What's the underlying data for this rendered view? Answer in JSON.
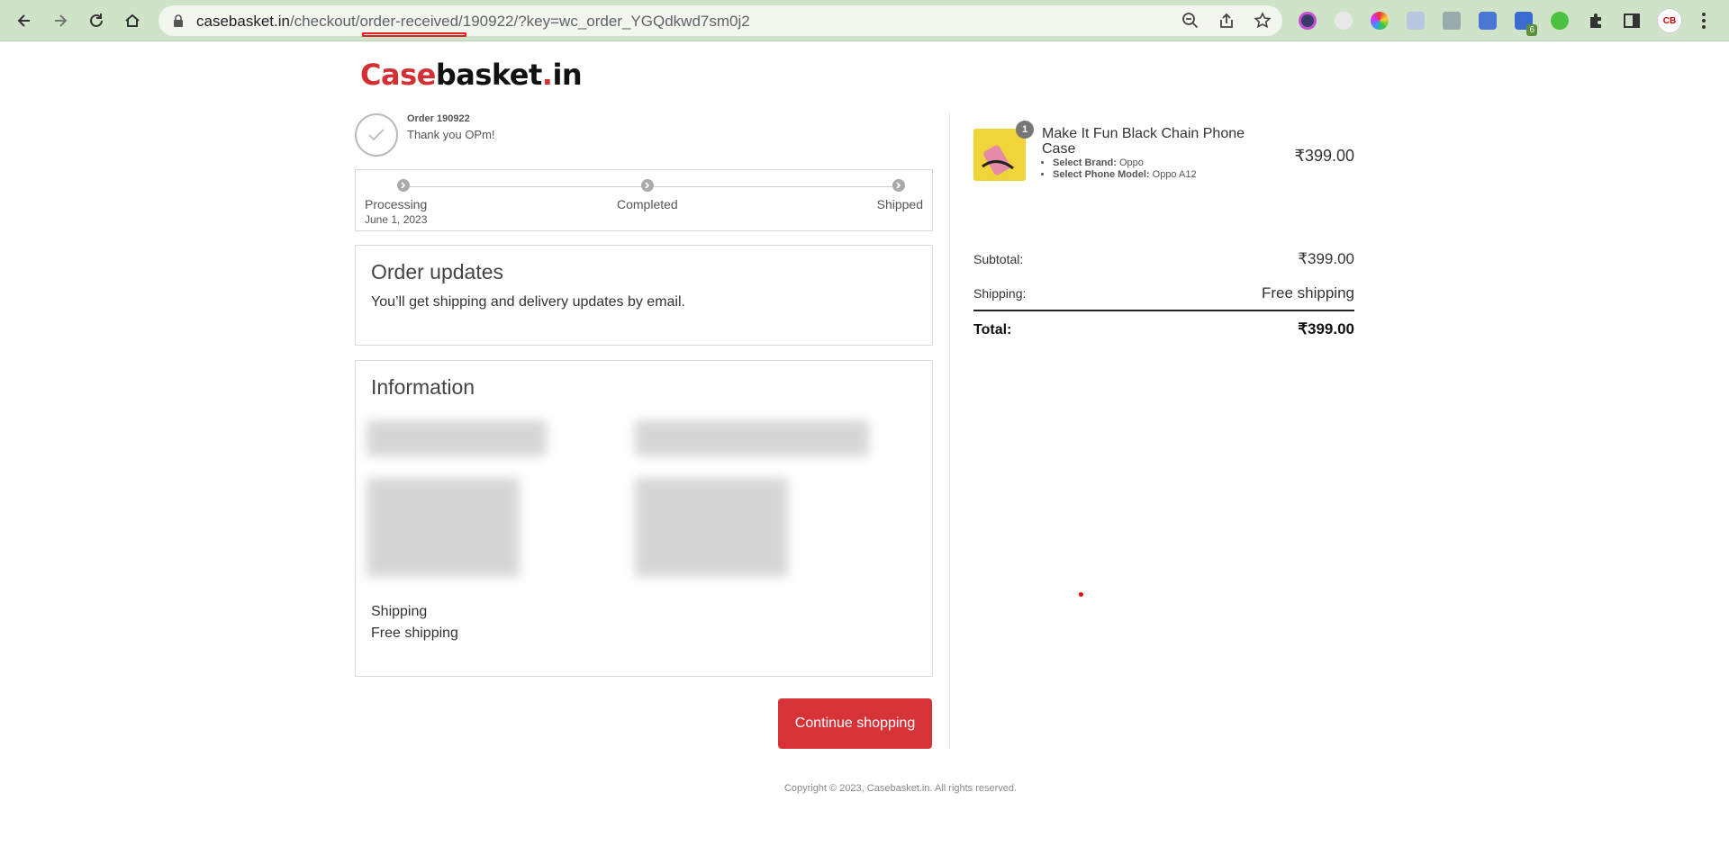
{
  "browser": {
    "url_host": "casebasket.in",
    "url_path": "/checkout/order-received/190922/?key=wc_order_YGQdkwd7sm0j2",
    "profile_initials": "CB",
    "extension_badge": "6"
  },
  "site": {
    "logo_case": "Case",
    "logo_basket": "basket",
    "logo_dot": ".",
    "logo_in": "in"
  },
  "order": {
    "number_label": "Order 190922",
    "thank_you": "Thank you OPm!"
  },
  "progress": {
    "steps": [
      {
        "label": "Processing",
        "date": "June 1, 2023"
      },
      {
        "label": "Completed",
        "date": ""
      },
      {
        "label": "Shipped",
        "date": ""
      }
    ]
  },
  "updates": {
    "title": "Order updates",
    "text": "You’ll get shipping and delivery updates by email."
  },
  "information": {
    "title": "Information",
    "shipping_label": "Shipping",
    "shipping_value": "Free shipping"
  },
  "actions": {
    "continue_label": "Continue shopping"
  },
  "cart": {
    "item": {
      "quantity": "1",
      "name": "Make It Fun Black Chain Phone Case",
      "brand_label": "Select Brand:",
      "brand_value": "Oppo",
      "model_label": "Select Phone Model:",
      "model_value": "Oppo A12",
      "price": "₹399.00"
    },
    "subtotal_label": "Subtotal:",
    "subtotal_value": "₹399.00",
    "shipping_label": "Shipping:",
    "shipping_value": "Free shipping",
    "total_label": "Total:",
    "total_value": "₹399.00"
  },
  "footer": {
    "copyright": "Copyright © 2023, Casebasket.in. All rights reserved."
  },
  "colors": {
    "brand_red": "#d33033",
    "button_red": "#d63339",
    "toolbar_green": "#cfe3c9"
  }
}
